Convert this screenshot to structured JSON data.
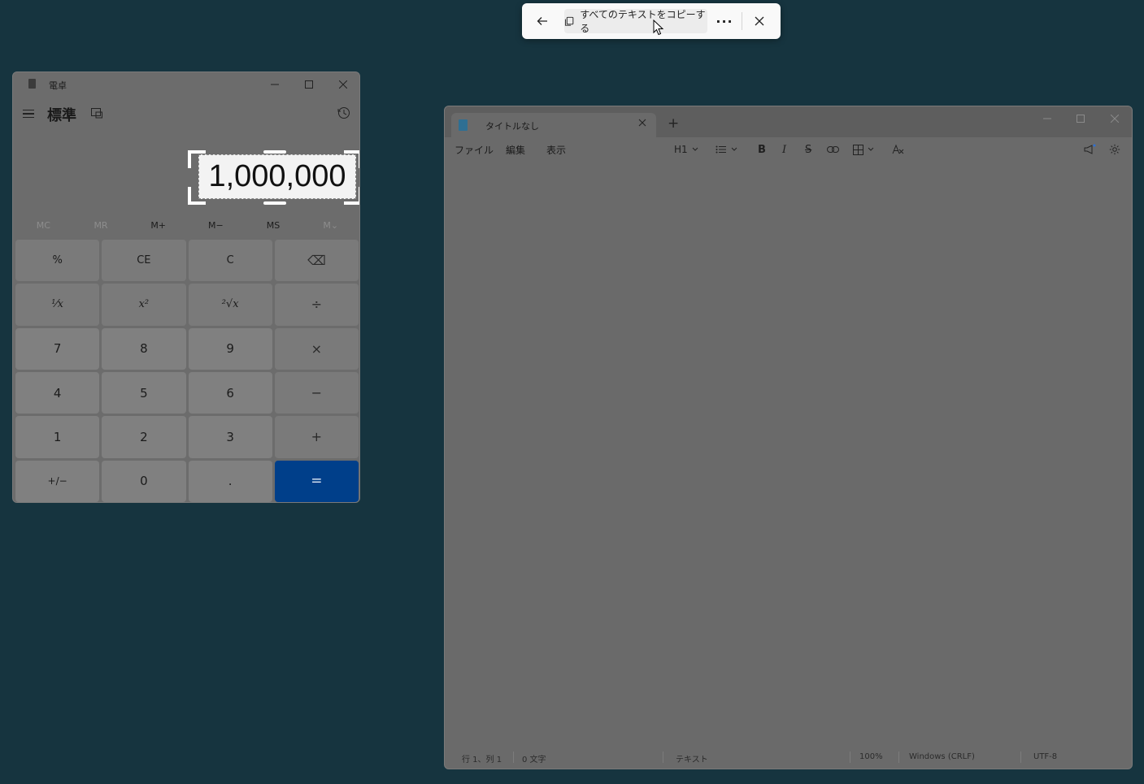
{
  "snip_toolbar": {
    "back_icon": "arrow-left-icon",
    "copy_all_label": "すべてのテキストをコピーする",
    "more_label": "···",
    "close_icon": "close-icon"
  },
  "calculator": {
    "title": "電卓",
    "mode": "標準",
    "display": "1,000,000",
    "memory": [
      "MC",
      "MR",
      "M+",
      "M−",
      "MS",
      "M⌄"
    ],
    "keys": [
      "%",
      "CE",
      "C",
      "⌫",
      "⅟x",
      "x²",
      "²√x",
      "÷",
      "7",
      "8",
      "9",
      "×",
      "4",
      "5",
      "6",
      "−",
      "1",
      "2",
      "3",
      "+",
      "+/−",
      "0",
      ".",
      "="
    ]
  },
  "notepad": {
    "tab_title": "タイトルなし",
    "new_tab": "+",
    "menu": {
      "file": "ファイル",
      "edit": "編集",
      "view": "表示"
    },
    "toolbar": {
      "heading": "H1",
      "bold": "B",
      "italic": "I",
      "strike": "S"
    },
    "status": {
      "position": "行 1、列 1",
      "chars": "0 文字",
      "format": "テキスト",
      "zoom": "100%",
      "line_ending": "Windows (CRLF)",
      "encoding": "UTF-8"
    }
  }
}
